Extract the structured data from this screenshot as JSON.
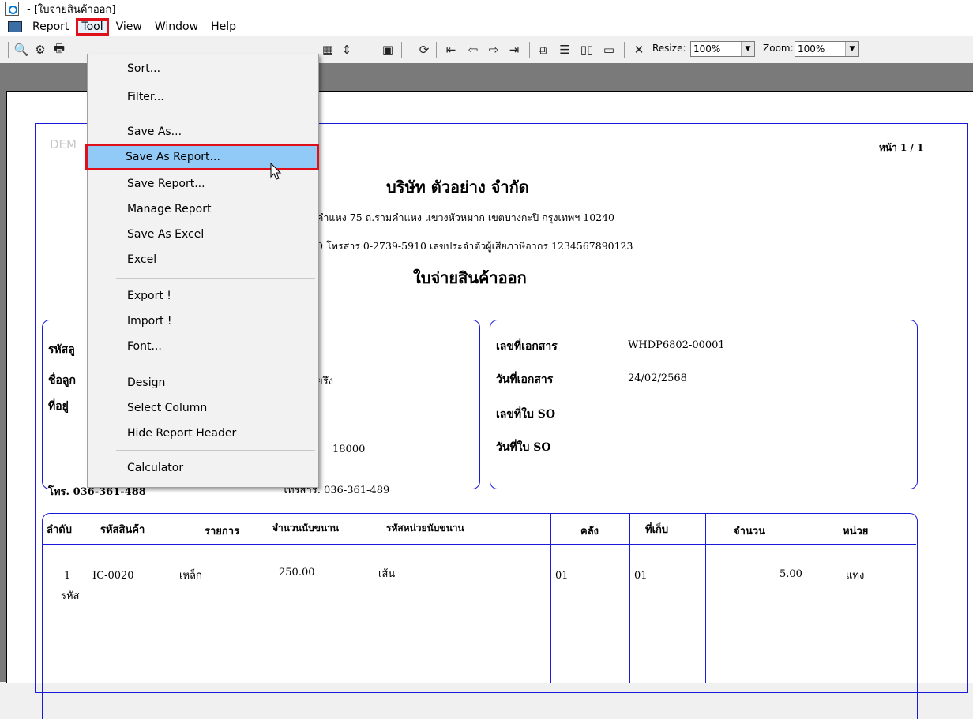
{
  "window": {
    "title": "- [ใบจ่ายสินค้าออก]"
  },
  "menubar": {
    "items": [
      "Report",
      "Tool",
      "View",
      "Window",
      "Help"
    ],
    "active": "Tool"
  },
  "toolbar": {
    "resize_label": "Resize:",
    "resize_value": "100%",
    "zoom_label": "Zoom:",
    "zoom_value": "100%"
  },
  "tool_menu": {
    "items": [
      "Sort...",
      "Filter...",
      "Save As...",
      "Save As Report...",
      "Save Report...",
      "Manage Report",
      "Save As Excel",
      "Excel",
      "Export !",
      "Import !",
      "Font...",
      "Design",
      "Select Column",
      "Hide Report Header",
      "Calculator"
    ],
    "highlighted": "Save As Report..."
  },
  "report": {
    "watermark": "DEM",
    "page": "หน้า 1 / 1",
    "company": "บริษัท ตัวอย่าง จำกัด",
    "address": "คำแหง 75 ถ.รามคำแหง แขวงหัวหมาก เขตบางกะปิ กรุงเทพฯ 10240",
    "contact": "0  โทรสาร 0-2739-5910  เลขประจำตัวผู้เสียภาษีอากร 1234567890123",
    "doc_title": "ใบจ่ายสินค้าออก",
    "left_box": {
      "code_label": "รหัสลู",
      "name_label": "ชื่อลูก",
      "address_label": "ที่อยู่",
      "name_value": "ยรึง",
      "postcode": "18000",
      "phone": "โทร. 036-361-488",
      "fax": "โทรสาร. 036-361-489"
    },
    "right_box": {
      "doc_no_label": "เลขที่เอกสาร",
      "doc_no_value": "WHDP6802-00001",
      "doc_date_label": "วันที่เอกสาร",
      "doc_date_value": "24/02/2568",
      "so_no_label": "เลขที่ใบ SO",
      "so_date_label": "วันที่ใบ SO"
    },
    "table": {
      "headers": [
        "ลำดับ",
        "รหัสสินค้า",
        "รายการ",
        "จำนวนนับขนาน",
        "รหัสหน่วยนับขนาน",
        "คลัง",
        "ที่เก็บ",
        "จำนวน",
        "หน่วย"
      ],
      "row": {
        "no": "1",
        "code": "IC-0020",
        "name": "เหล็ก",
        "count": "250.00",
        "count_unit": "เส้น",
        "warehouse": "01",
        "location": "01",
        "qty": "5.00",
        "unit": "แท่ง",
        "extra": "รหัส"
      }
    }
  }
}
